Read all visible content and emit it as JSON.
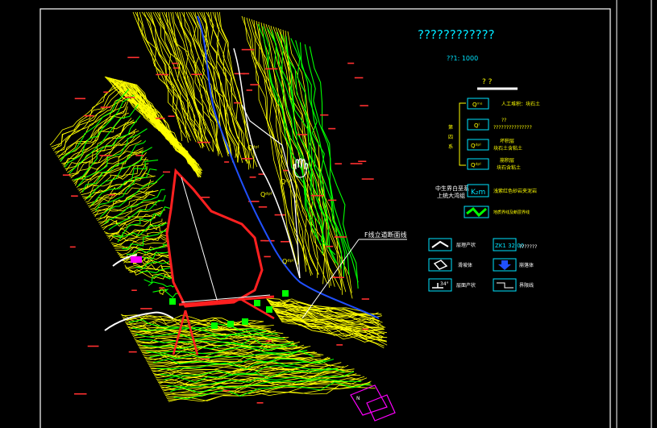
{
  "drawing": {
    "title": "????????????",
    "scale": "??1: 1000",
    "legend_heading": "? ?",
    "section_label": "F线立道断面线",
    "side_chars": [
      "第",
      "四",
      "系"
    ],
    "strata": [
      {
        "code": "Qᵐˢ",
        "desc": "人工堆积：块石土"
      },
      {
        "code": "Qˡ",
        "desc": "???????????????",
        "desc2": "??"
      },
      {
        "code": "Qᵈᵖˡ",
        "desc": "坏积层",
        "desc2": "块石土含粘土"
      },
      {
        "code": "Qᵈᵖˡ",
        "desc": "崩积层",
        "desc2": "块石含粘土"
      }
    ],
    "bedrock": {
      "left": "中生界白垩系",
      "left2": "上统大湾组",
      "code": "K₂m",
      "desc": "浅紫红色砂岩夹泥岩"
    },
    "boundary": {
      "desc": "地质界线及断层界线"
    },
    "symbols": [
      {
        "label": "层理产状",
        "label2": ""
      },
      {
        "code": "ZK1 32.00",
        "label": "???????"
      },
      {
        "label": "滑坡体",
        "label2": ""
      },
      {
        "label": "崩落体",
        "label2": ""
      },
      {
        "code": "34°",
        "label": "层面产状"
      },
      {
        "label": "界限线"
      }
    ],
    "map_labels": {
      "q1": "Qˡ",
      "q2": "Qˡ",
      "q3": "Qᵈᵖˡ",
      "q4": "Qᵈᵖˡ",
      "q5": "Qᵈᵖˡ",
      "q6": "Qᵈᵖˡ",
      "n": "N"
    },
    "colors": {
      "background": "#000000",
      "frame": "#ffffff",
      "contour_yellow": "#ffff00",
      "contour_green": "#00ff00",
      "outline_red": "#ff2020",
      "water_blue": "#2050ff",
      "title_cyan": "#00e5ff",
      "magenta": "#ff00ff",
      "annotation_red": "#ff3030"
    }
  }
}
